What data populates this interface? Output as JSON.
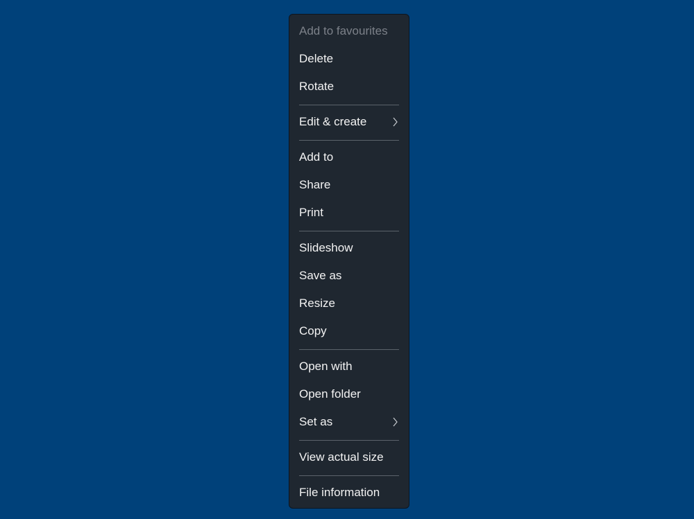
{
  "menu": {
    "items": [
      {
        "label": "Add to favourites",
        "disabled": true
      },
      {
        "label": "Delete"
      },
      {
        "label": "Rotate"
      },
      {
        "label": "Edit & create",
        "submenu": true
      },
      {
        "label": "Add to"
      },
      {
        "label": "Share"
      },
      {
        "label": "Print"
      },
      {
        "label": "Slideshow"
      },
      {
        "label": "Save as"
      },
      {
        "label": "Resize"
      },
      {
        "label": "Copy"
      },
      {
        "label": "Open with"
      },
      {
        "label": "Open folder"
      },
      {
        "label": "Set as",
        "submenu": true
      },
      {
        "label": "View actual size"
      },
      {
        "label": "File information"
      }
    ]
  }
}
